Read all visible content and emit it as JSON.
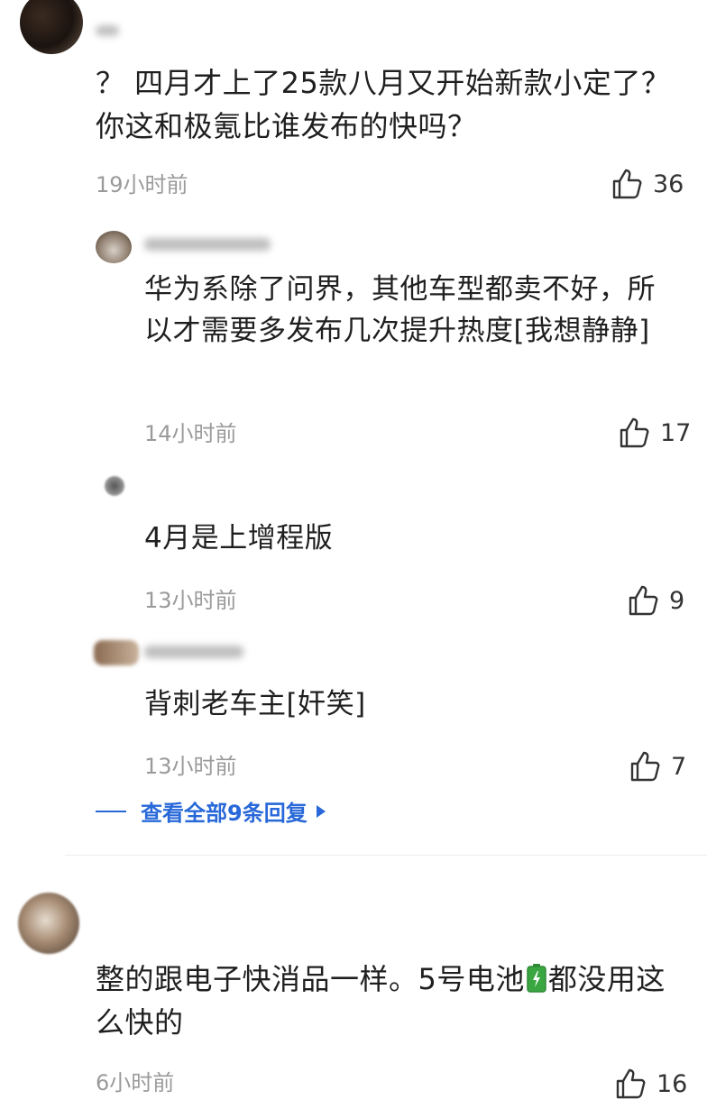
{
  "comments": [
    {
      "text": "？ 四月才上了25款八月又开始新款小定了？你这和极氪比谁发布的快吗？",
      "time": "19小时前",
      "likes": "36",
      "replies": [
        {
          "text": "华为系除了问界，其他车型都卖不好，所以才需要多发布几次提升热度[我想静静]",
          "time": "14小时前",
          "likes": "17"
        },
        {
          "text": "4月是上增程版",
          "time": "13小时前",
          "likes": "9"
        },
        {
          "text": "背刺老车主[奸笑]",
          "time": "13小时前",
          "likes": "7"
        }
      ],
      "view_all": "查看全部9条回复"
    },
    {
      "text_before_icon": "整的跟电子快消品一样。5号电池",
      "text_after_icon": "都没用这么快的",
      "icon": "battery-emoji",
      "time": "6小时前",
      "likes": "16"
    }
  ],
  "colors": {
    "link": "#2868d8",
    "time": "#9a9a9a",
    "battery": "#3aa641"
  }
}
